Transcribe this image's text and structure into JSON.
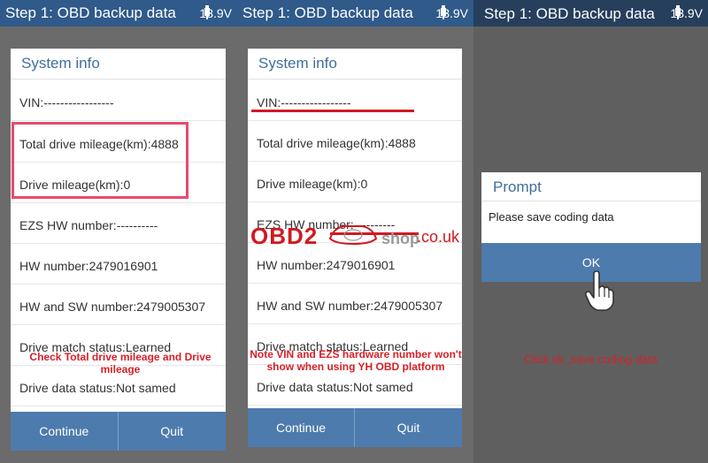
{
  "header": {
    "title": "Step 1: OBD backup data",
    "voltage": "13.9V"
  },
  "system_info": {
    "title": "System info",
    "rows": [
      "VIN:-----------------",
      "Total drive mileage(km):4888",
      "Drive mileage(km):0",
      "EZS HW number:----------",
      "HW number:2479016901",
      "HW and SW number:2479005307",
      "Drive match status:Learned",
      "Drive data status:Not samed"
    ],
    "continue_label": "Continue",
    "quit_label": "Quit"
  },
  "annotations": {
    "note1": "Check Total drive mileage and Drive mileage",
    "note2": "Note VIN and EZS hardware number won't show when using YH OBD platform",
    "note3": "Click ok ,save coding data",
    "highlight_color": "#e94a6e",
    "note_color": "#d81f26"
  },
  "prompt": {
    "title": "Prompt",
    "message": "Please save coding data",
    "ok_label": "OK"
  },
  "watermark": {
    "brand": "OBD2",
    "suffix": ".co.uk",
    "shop": "shop"
  },
  "colors": {
    "header_bg": "#2f5a8a",
    "button_bg": "#4d7bad",
    "title_text": "#3f6e9e"
  }
}
